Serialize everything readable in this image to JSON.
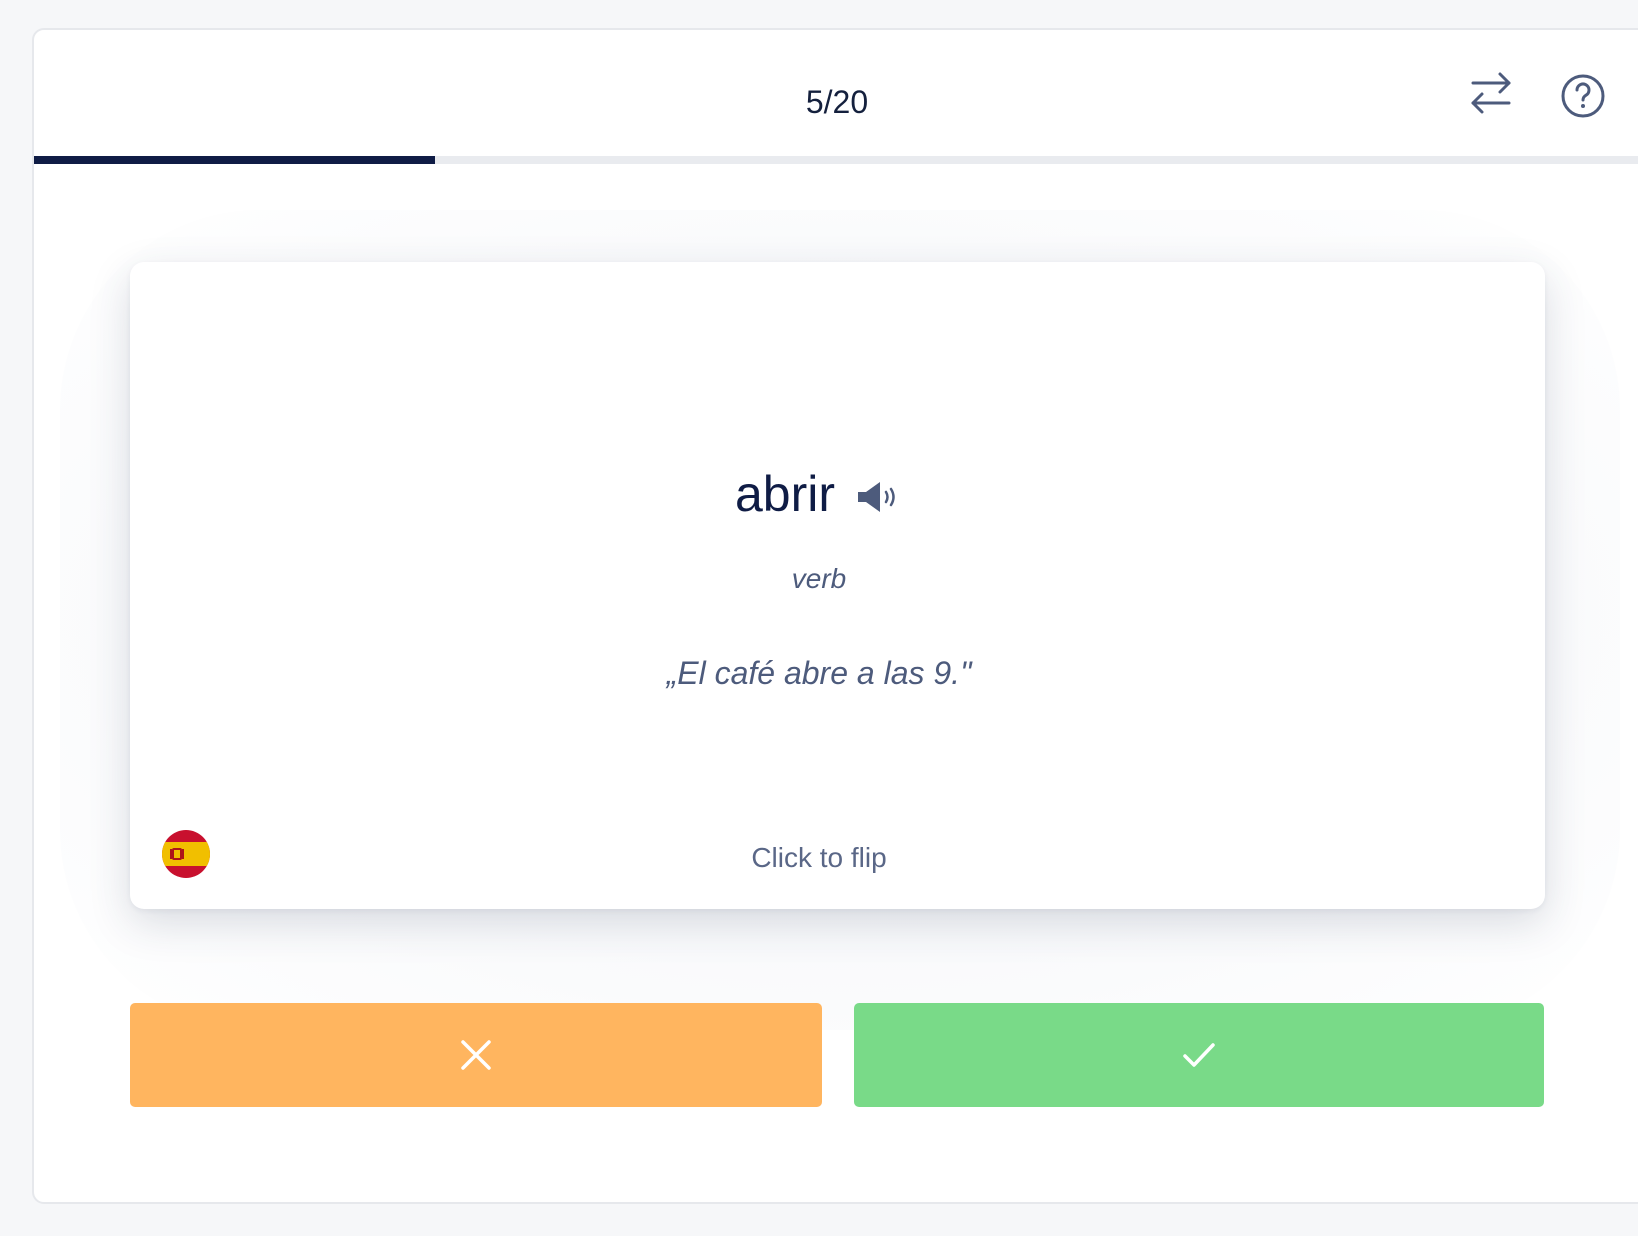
{
  "header": {
    "counter": "5/20",
    "progress": 0.25
  },
  "card": {
    "word": "abrir",
    "part_of_speech": "verb",
    "example": "„El café abre a las 9.\"",
    "flip_hint": "Click to flip",
    "language_flag": "spain-flag-icon"
  },
  "colors": {
    "accent": "#0f1c45",
    "wrong": "#ffb55f",
    "right": "#79da88",
    "icon": "#4d5b7c"
  },
  "icons": {
    "swap": "swap-arrows-icon",
    "help": "help-circle-icon",
    "speaker": "speaker-icon",
    "wrong": "close-icon",
    "right": "checkmark-icon"
  }
}
